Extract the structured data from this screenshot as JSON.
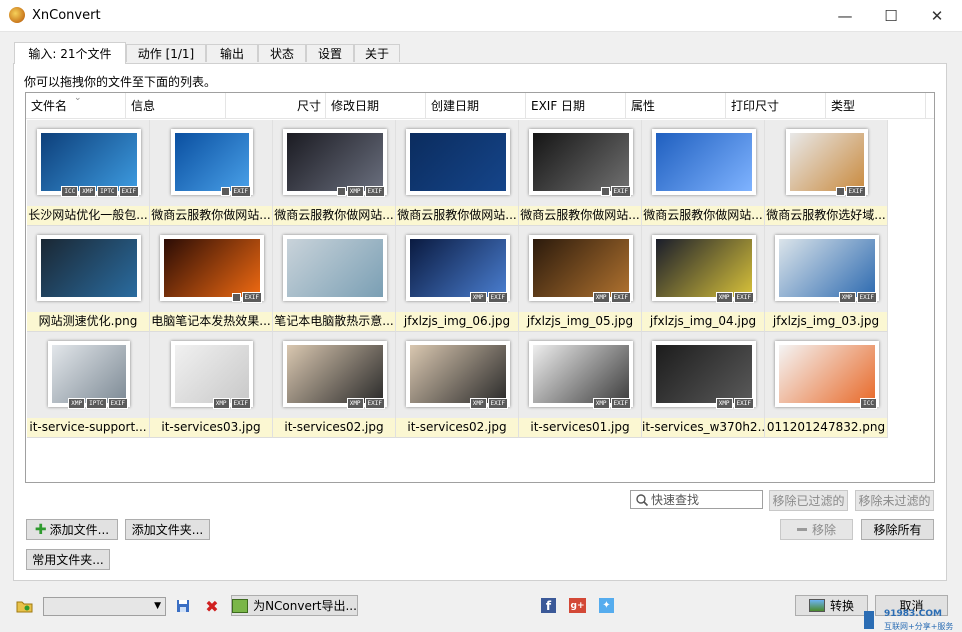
{
  "window": {
    "title": "XnConvert"
  },
  "tabs": [
    "输入: 21个文件",
    "动作 [1/1]",
    "输出",
    "状态",
    "设置",
    "关于"
  ],
  "hint": "你可以拖拽你的文件至下面的列表。",
  "columns": [
    "文件名",
    "信息",
    "尺寸",
    "修改日期",
    "创建日期",
    "EXIF 日期",
    "属性",
    "打印尺寸",
    "类型"
  ],
  "files": [
    {
      "name": "长沙网站优化一般包...",
      "badges": [
        "ICC",
        "XMP",
        "IPTC",
        "EXIF"
      ],
      "colors": [
        "#0d3f7a",
        "#3d9be0"
      ]
    },
    {
      "name": "微商云服教你做网站...",
      "badges": [
        "■",
        "EXIF"
      ],
      "colors": [
        "#0a4fa0",
        "#49a0e8"
      ]
    },
    {
      "name": "微商云服教你做网站...",
      "badges": [
        "■",
        "XMP",
        "EXIF"
      ],
      "colors": [
        "#1b1b22",
        "#6a6f7e"
      ]
    },
    {
      "name": "微商云服教你做网站...",
      "badges": [],
      "colors": [
        "#0b2c5e",
        "#15458a"
      ]
    },
    {
      "name": "微商云服教你做网站...",
      "badges": [
        "■",
        "EXIF"
      ],
      "colors": [
        "#151515",
        "#707070"
      ]
    },
    {
      "name": "微商云服教你做网站...",
      "badges": [],
      "colors": [
        "#1f5fbf",
        "#7fb3ff"
      ]
    },
    {
      "name": "微商云服教你选好域...",
      "badges": [
        "■",
        "EXIF"
      ],
      "colors": [
        "#e8e8e8",
        "#c98a3e"
      ]
    },
    {
      "name": "网站测速优化.png",
      "badges": [],
      "colors": [
        "#1a2733",
        "#2a6ca0"
      ]
    },
    {
      "name": "电脑笔记本发热效果...",
      "badges": [
        "■",
        "EXIF"
      ],
      "colors": [
        "#2b0c05",
        "#f06a12"
      ]
    },
    {
      "name": "笔记本电脑散热示意...",
      "badges": [],
      "colors": [
        "#c9d3da",
        "#7a9fb4"
      ]
    },
    {
      "name": "jfxlzjs_img_06.jpg",
      "badges": [
        "XMP",
        "EXIF"
      ],
      "colors": [
        "#0a1a40",
        "#4a7ed0"
      ]
    },
    {
      "name": "jfxlzjs_img_05.jpg",
      "badges": [
        "XMP",
        "EXIF"
      ],
      "colors": [
        "#2b1a0c",
        "#b0722f"
      ]
    },
    {
      "name": "jfxlzjs_img_04.jpg",
      "badges": [
        "XMP",
        "EXIF"
      ],
      "colors": [
        "#1a1d2b",
        "#d8c23a"
      ]
    },
    {
      "name": "jfxlzjs_img_03.jpg",
      "badges": [
        "XMP",
        "EXIF"
      ],
      "colors": [
        "#dbe4ea",
        "#2d6ab0"
      ]
    },
    {
      "name": "it-service-support...",
      "badges": [
        "XMP",
        "IPTC",
        "EXIF"
      ],
      "colors": [
        "#e2e6ea",
        "#7d8a95"
      ]
    },
    {
      "name": "it-services03.jpg",
      "badges": [
        "XMP",
        "EXIF"
      ],
      "colors": [
        "#f1f1f1",
        "#c8c8c8"
      ]
    },
    {
      "name": "it-services02.jpg",
      "badges": [
        "XMP",
        "EXIF"
      ],
      "colors": [
        "#d9c7b0",
        "#2a2a2a"
      ]
    },
    {
      "name": "it-services02.jpg",
      "badges": [
        "XMP",
        "EXIF"
      ],
      "colors": [
        "#d9c7b0",
        "#2a2a2a"
      ]
    },
    {
      "name": "it-services01.jpg",
      "badges": [
        "XMP",
        "EXIF"
      ],
      "colors": [
        "#eeeeee",
        "#3c3c3c"
      ]
    },
    {
      "name": "it-services_w370h2...",
      "badges": [
        "XMP",
        "EXIF"
      ],
      "colors": [
        "#1c1c1c",
        "#5a5a5a"
      ]
    },
    {
      "name": "011201247832.png",
      "badges": [
        "ICC"
      ],
      "colors": [
        "#f4f4f4",
        "#e86a2a"
      ]
    }
  ],
  "search": {
    "placeholder": "快速查找"
  },
  "buttons": {
    "remove_filtered": "移除已过滤的",
    "remove_unfiltered": "移除未过滤的",
    "add_files": "添加文件...",
    "add_folder": "添加文件夹...",
    "remove": "移除",
    "remove_all": "移除所有",
    "common_folders": "常用文件夹...",
    "export_nconvert": "为NConvert导出...",
    "convert": "转换",
    "cancel": "取消"
  },
  "watermark": {
    "line1": "91983.COM",
    "line2": "互联网+分享+服务"
  }
}
